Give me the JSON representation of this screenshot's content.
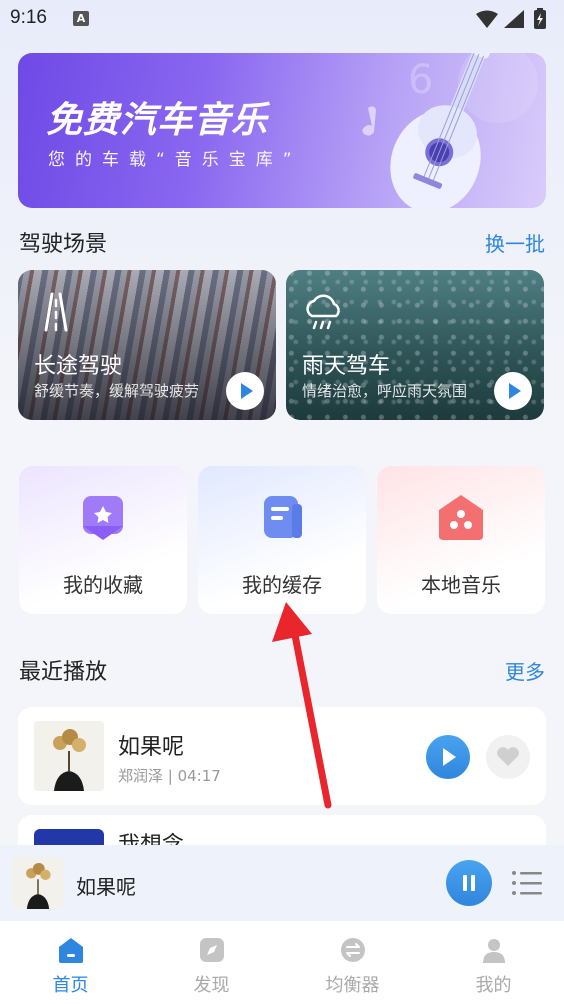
{
  "status_bar": {
    "time": "9:16",
    "notif_letter": "A"
  },
  "banner": {
    "title": "免费汽车音乐",
    "subtitle": "您的车载“音乐宝库”"
  },
  "driving_scene": {
    "title": "驾驶场景",
    "refresh_label": "换一批",
    "cards": [
      {
        "title": "长途驾驶",
        "desc": "舒缓节奏，缓解驾驶疲劳",
        "icon": "road-icon"
      },
      {
        "title": "雨天驾车",
        "desc": "情绪治愈，呼应雨天氛围",
        "icon": "rain-cloud-icon"
      }
    ]
  },
  "quick_tiles": [
    {
      "label": "我的收藏",
      "icon": "star-bookmark-icon",
      "color": "#8b5cf6"
    },
    {
      "label": "我的缓存",
      "icon": "document-cache-icon",
      "color": "#5b7be8"
    },
    {
      "label": "本地音乐",
      "icon": "house-icon",
      "color": "#f25b5b"
    }
  ],
  "recent": {
    "title": "最近播放",
    "more_label": "更多",
    "songs": [
      {
        "title": "如果呢",
        "meta": "郑润泽 | 04:17"
      },
      {
        "title": "我想念"
      }
    ]
  },
  "mini_player": {
    "title": "如果呢"
  },
  "bottom_nav": [
    {
      "label": "首页",
      "icon": "home-icon",
      "active": true
    },
    {
      "label": "发现",
      "icon": "compass-icon",
      "active": false
    },
    {
      "label": "均衡器",
      "icon": "equalizer-icon",
      "active": false
    },
    {
      "label": "我的",
      "icon": "person-icon",
      "active": false
    }
  ],
  "colors": {
    "accent": "#2e86de",
    "arrow": "#e8262b"
  }
}
